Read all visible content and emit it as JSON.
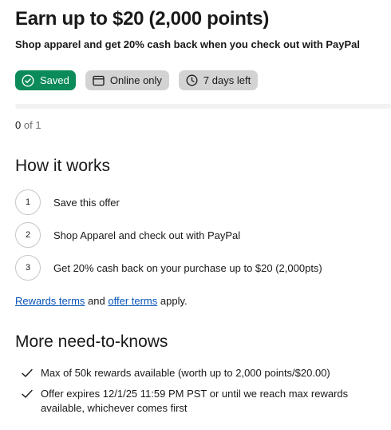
{
  "offer": {
    "title": "Earn up to $20 (2,000 points)",
    "subtitle": "Shop apparel and get 20% cash back when you check out with PayPal"
  },
  "chips": {
    "saved": "Saved",
    "online": "Online only",
    "days": "7 days left"
  },
  "progress": {
    "fraction": 0,
    "count": "0",
    "of_text": "of 1"
  },
  "how_it_works": {
    "heading": "How it works",
    "steps": [
      {
        "num": "1",
        "text": "Save this offer"
      },
      {
        "num": "2",
        "text": "Shop Apparel and check out with PayPal"
      },
      {
        "num": "3",
        "text": "Get 20% cash back on your purchase up to $20 (2,000pts)"
      }
    ]
  },
  "terms": {
    "rewards_link": "Rewards terms",
    "and": "and",
    "offer_link": "offer terms",
    "apply": "apply."
  },
  "need_to_knows": {
    "heading": "More need-to-knows",
    "items": [
      "Max of 50k rewards available (worth up to 2,000 points/$20.00)",
      "Offer expires 12/1/25 11:59 PM PST or until we reach max rewards available, whichever comes first"
    ]
  },
  "colors": {
    "saved_green": "#0b8a5a",
    "chip_gray": "#d3d3d3",
    "link_blue": "#0654ba"
  },
  "icons": {
    "saved": "check-circle-icon",
    "online": "window-icon",
    "days": "clock-icon",
    "list": "checkmark-icon"
  }
}
